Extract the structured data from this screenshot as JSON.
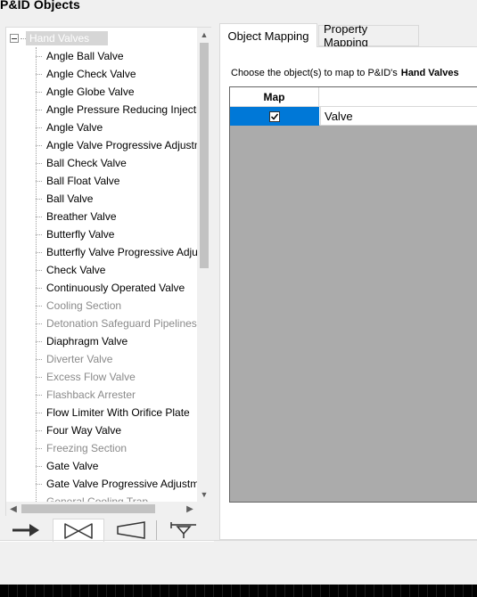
{
  "window": {
    "title": "P&ID Objects"
  },
  "tree": {
    "root_label": "Hand Valves",
    "items": [
      {
        "label": "Angle Ball Valve",
        "dim": false
      },
      {
        "label": "Angle Check Valve",
        "dim": false
      },
      {
        "label": "Angle Globe Valve",
        "dim": false
      },
      {
        "label": "Angle Pressure Reducing Injectio",
        "dim": false
      },
      {
        "label": "Angle Valve",
        "dim": false
      },
      {
        "label": "Angle Valve Progressive Adjustm",
        "dim": false
      },
      {
        "label": "Ball Check Valve",
        "dim": false
      },
      {
        "label": "Ball Float Valve",
        "dim": false
      },
      {
        "label": "Ball Valve",
        "dim": false
      },
      {
        "label": "Breather Valve",
        "dim": false
      },
      {
        "label": "Butterfly Valve",
        "dim": false
      },
      {
        "label": "Butterfly Valve Progressive Adjus",
        "dim": false
      },
      {
        "label": "Check Valve",
        "dim": false
      },
      {
        "label": "Continuously Operated Valve",
        "dim": false
      },
      {
        "label": "Cooling Section",
        "dim": true
      },
      {
        "label": "Detonation Safeguard Pipelines",
        "dim": true
      },
      {
        "label": "Diaphragm Valve",
        "dim": false
      },
      {
        "label": "Diverter Valve",
        "dim": true
      },
      {
        "label": "Excess Flow Valve",
        "dim": true
      },
      {
        "label": "Flashback Arrester",
        "dim": true
      },
      {
        "label": "Flow Limiter With Orifice Plate",
        "dim": false
      },
      {
        "label": "Four Way Valve",
        "dim": false
      },
      {
        "label": "Freezing Section",
        "dim": true
      },
      {
        "label": "Gate Valve",
        "dim": false
      },
      {
        "label": "Gate Valve Progressive Adjustme",
        "dim": false
      },
      {
        "label": "General Cooling Trap",
        "dim": true
      }
    ]
  },
  "icon_tabs": [
    {
      "name": "arrow-icon"
    },
    {
      "name": "valve-icon"
    },
    {
      "name": "reducer-icon"
    },
    {
      "name": "nozzle-icon"
    }
  ],
  "tabs": {
    "object_mapping": "Object Mapping",
    "property_mapping": "Property Mapping"
  },
  "mapping": {
    "instruction": "Choose the object(s) to map to P&ID's",
    "target": "Hand Valves",
    "column_map": "Map",
    "rows": [
      {
        "checked": true,
        "name": "Valve"
      }
    ]
  },
  "colors": {
    "selection": "#0078d7",
    "grid_bg": "#ababab",
    "dim_text": "#8a8a8a"
  }
}
